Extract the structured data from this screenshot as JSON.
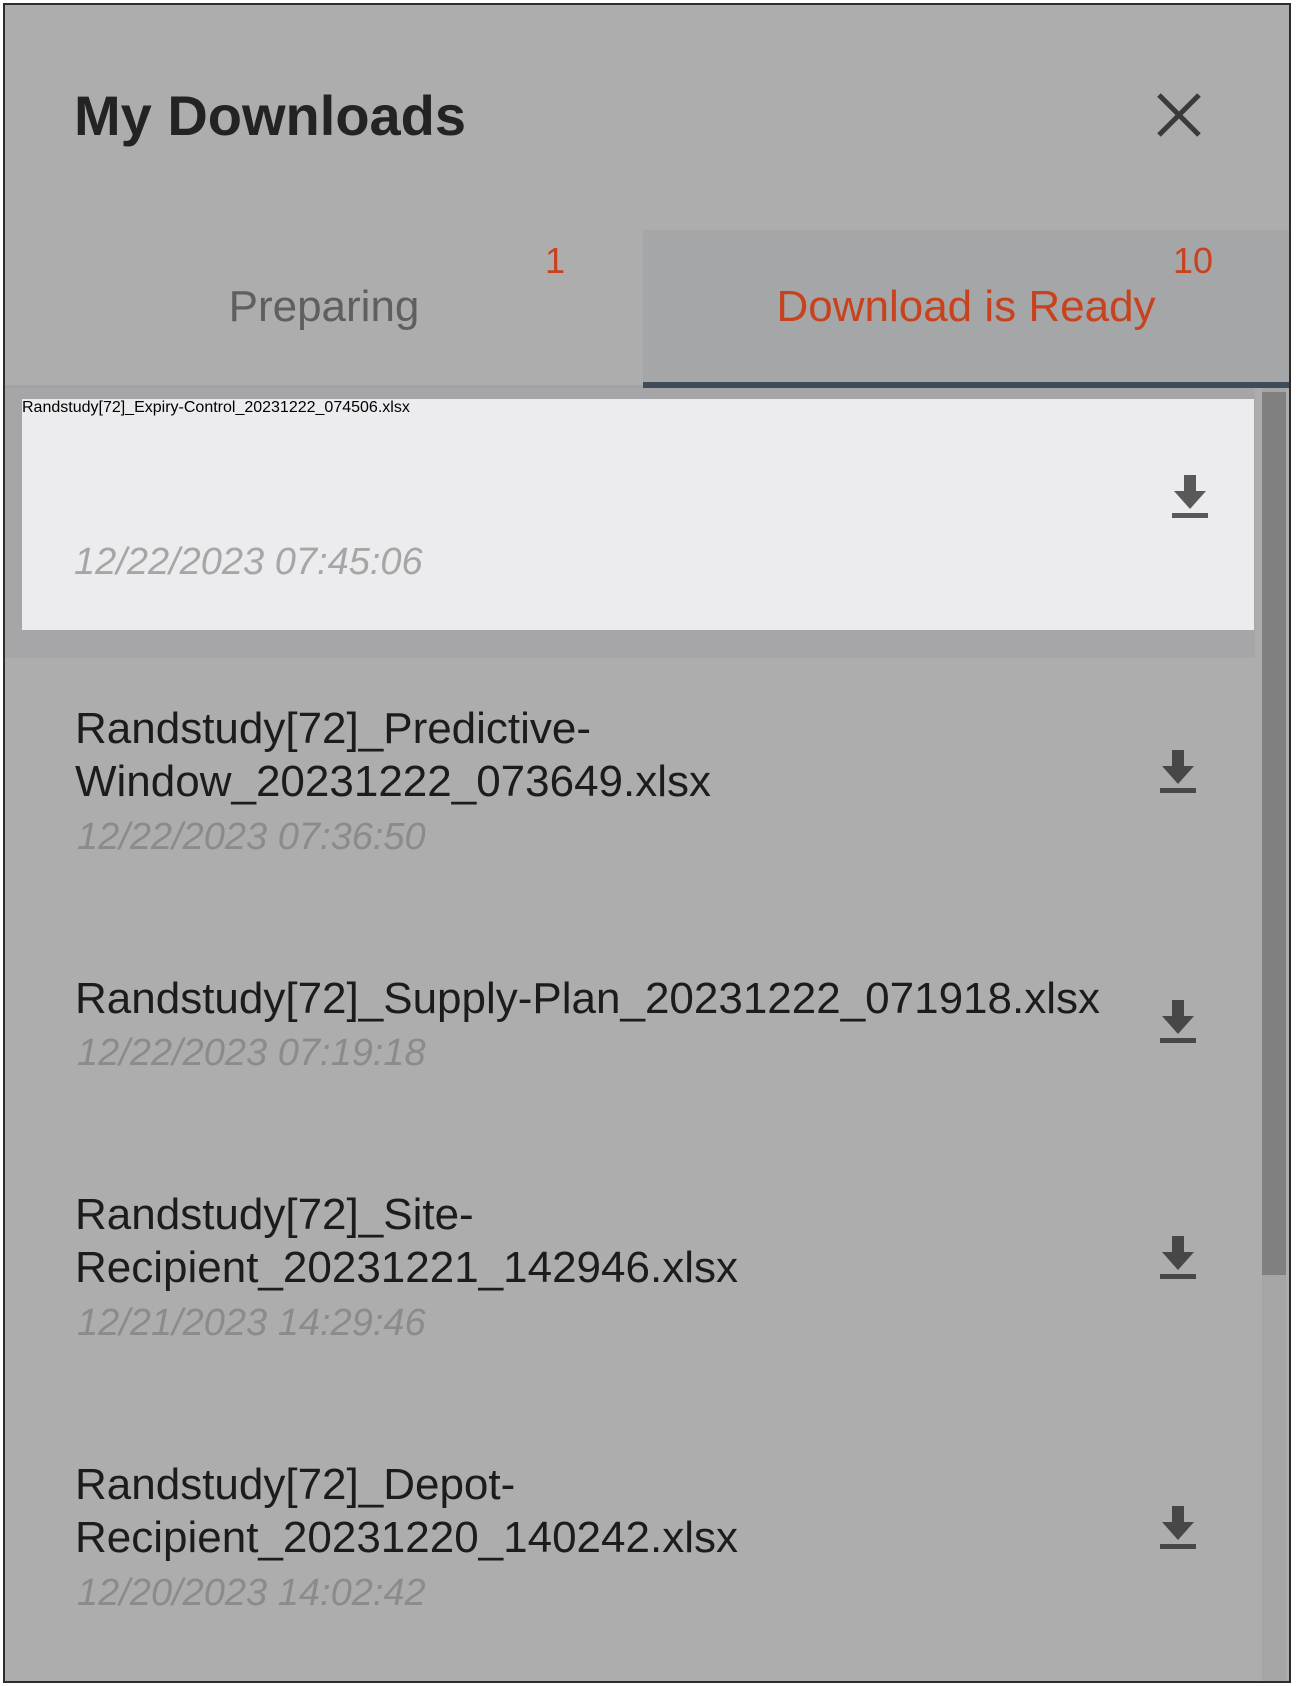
{
  "header": {
    "title": "My Downloads"
  },
  "tabs": [
    {
      "label": "Preparing",
      "count": "1"
    },
    {
      "label": "Download is Ready",
      "count": "10"
    }
  ],
  "downloads": [
    {
      "name": "Randstudy[72]_Expiry-Control_20231222_074506.xlsx",
      "time": "12/22/2023 07:45:06"
    },
    {
      "name": "Randstudy[72]_Predictive-Window_20231222_073649.xlsx",
      "time": "12/22/2023 07:36:50"
    },
    {
      "name": "Randstudy[72]_Supply-Plan_20231222_071918.xlsx",
      "time": "12/22/2023 07:19:18"
    },
    {
      "name": "Randstudy[72]_Site-Recipient_20231221_142946.xlsx",
      "time": "12/21/2023 14:29:46"
    },
    {
      "name": "Randstudy[72]_Depot-Recipient_20231220_140242.xlsx",
      "time": "12/20/2023 14:02:42"
    }
  ],
  "colors": {
    "accent": "#c8421d",
    "active_tab_underline": "#3f4c57",
    "overlay": "#adadad"
  },
  "icons": {
    "close": "close-icon",
    "download": "download-icon"
  }
}
